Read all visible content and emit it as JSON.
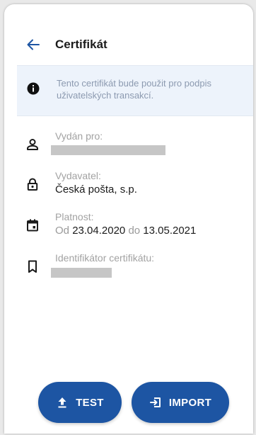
{
  "header": {
    "title": "Certifikát"
  },
  "info": {
    "text": "Tento certifikát bude použit pro podpis\nuživatelských transakcí."
  },
  "fields": {
    "issued_to": {
      "label": "Vydán pro:"
    },
    "issuer": {
      "label": "Vydavatel:",
      "value": "Česká pošta, s.p."
    },
    "validity": {
      "label": "Platnost:",
      "from_prefix": "Od",
      "from_date": "23.04.2020",
      "to_prefix": "do",
      "to_date": "13.05.2021"
    },
    "identifier": {
      "label": "Identifikátor certifikátu:"
    }
  },
  "buttons": {
    "test_label": "TEST",
    "import_label": "IMPORT"
  },
  "colors": {
    "accent": "#1d55a3",
    "info_background": "#edf3fb",
    "redaction": "#c6c6c6"
  },
  "icons": {
    "back": "arrow-left-icon",
    "info": "info-icon",
    "issued_to": "person-icon",
    "issuer": "lock-icon",
    "validity": "calendar-icon",
    "identifier": "bookmark-icon",
    "test": "upload-icon",
    "import": "login-icon"
  }
}
